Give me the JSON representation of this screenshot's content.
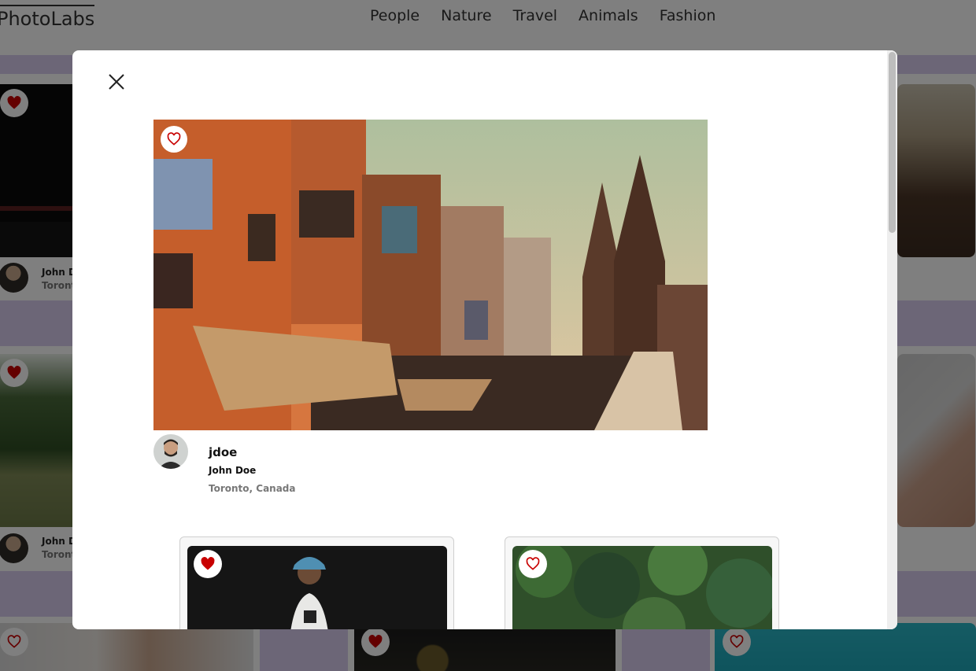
{
  "app": {
    "logo": "PhotoLabs"
  },
  "nav": {
    "topics": [
      "People",
      "Nature",
      "Travel",
      "Animals",
      "Fashion"
    ]
  },
  "background_cards": [
    {
      "name": "John D",
      "location": "Toront"
    },
    {
      "name": "John D",
      "location": "Toront"
    }
  ],
  "modal": {
    "close_icon": "close-icon",
    "photo": {
      "description_icon": "photo",
      "favourited": false
    },
    "user": {
      "username": "jdoe",
      "full_name": "John Doe",
      "location": "Toronto, Canada"
    },
    "similar_photos": [
      {
        "favourited": true
      },
      {
        "favourited": false
      }
    ]
  },
  "colors": {
    "heart": "#c80000",
    "band": "#d9cdef",
    "overlay": "#000000"
  }
}
